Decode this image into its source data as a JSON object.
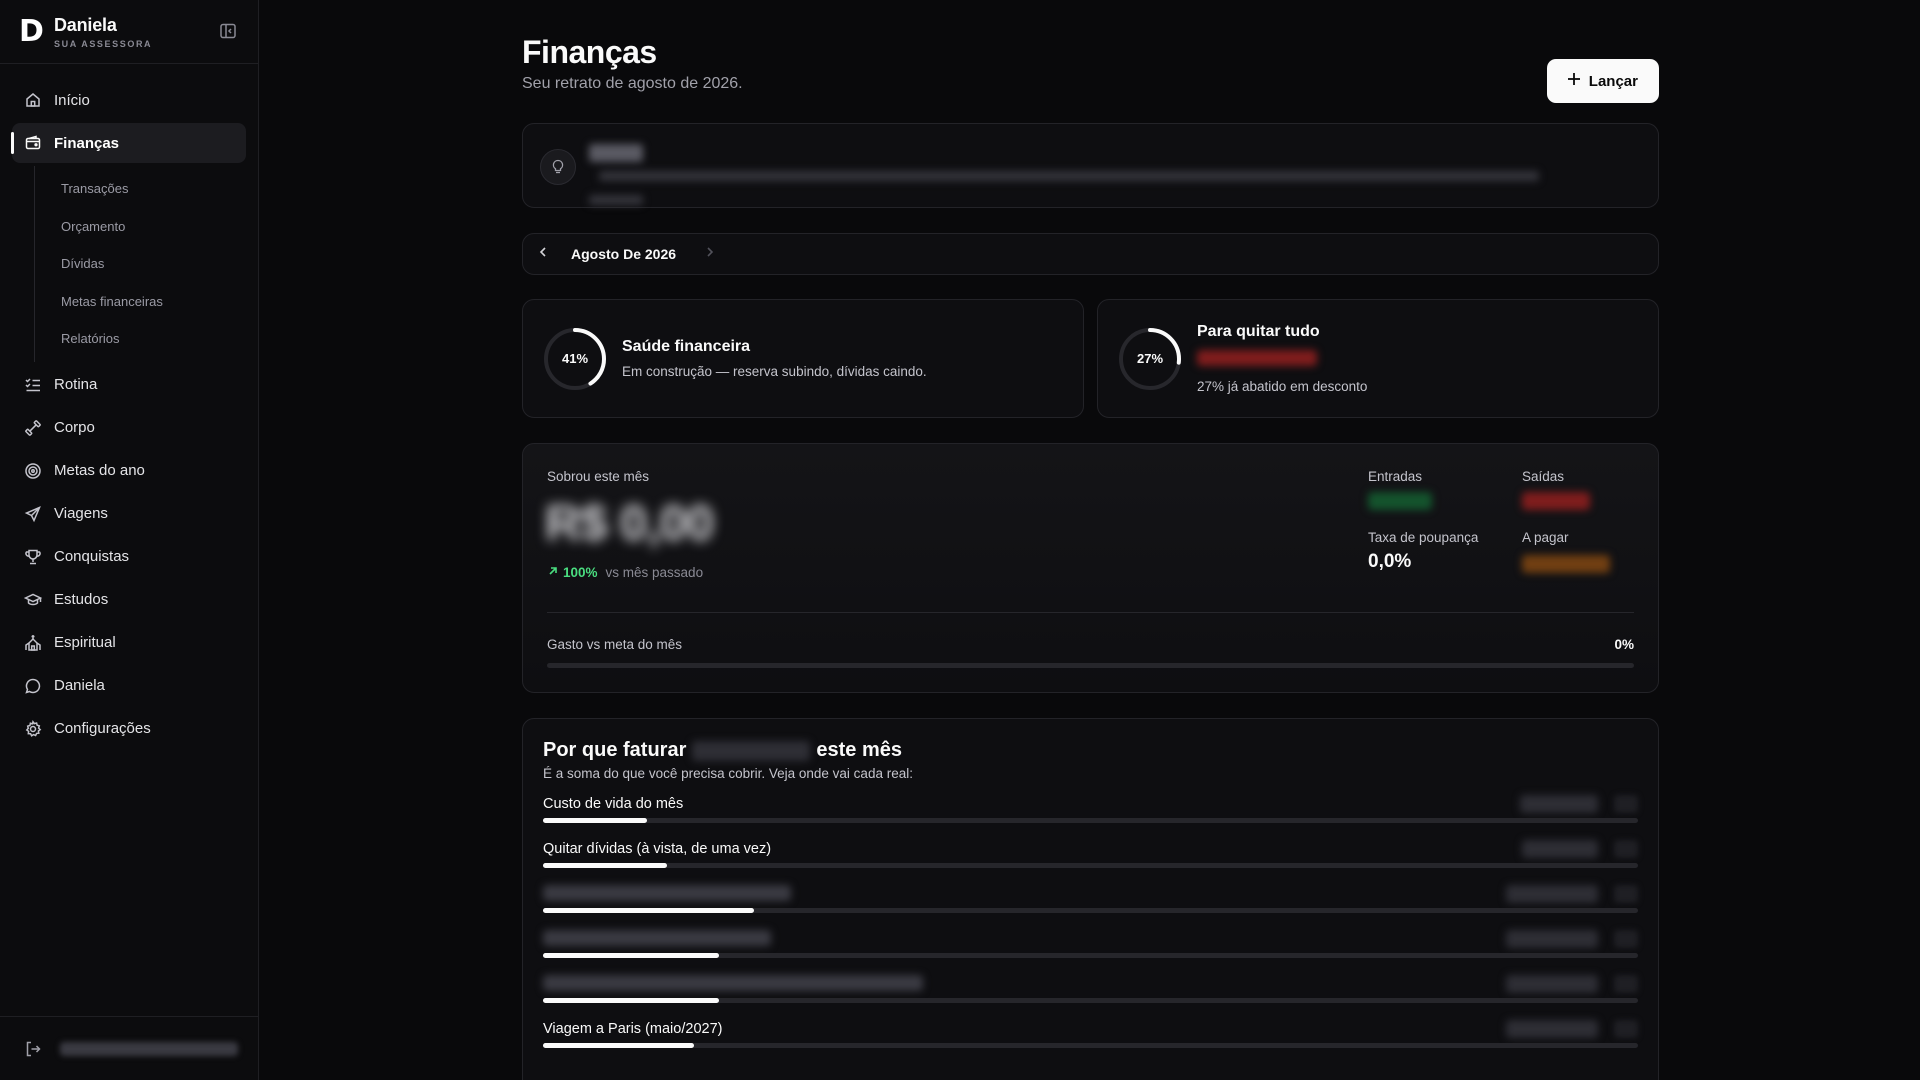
{
  "brand": {
    "logo": "D",
    "name": "Daniela",
    "subtitle": "SUA ASSESSORA"
  },
  "nav": {
    "items": [
      {
        "label": "Início",
        "icon": "home-icon"
      },
      {
        "label": "Finanças",
        "icon": "wallet-icon",
        "active": true
      },
      {
        "label": "Rotina",
        "icon": "list-checks-icon"
      },
      {
        "label": "Corpo",
        "icon": "dumbbell-icon"
      },
      {
        "label": "Metas do ano",
        "icon": "target-icon"
      },
      {
        "label": "Viagens",
        "icon": "plane-icon"
      },
      {
        "label": "Conquistas",
        "icon": "trophy-icon"
      },
      {
        "label": "Estudos",
        "icon": "graduation-cap-icon"
      },
      {
        "label": "Espiritual",
        "icon": "church-icon"
      },
      {
        "label": "Daniela",
        "icon": "chat-bubble-icon"
      },
      {
        "label": "Configurações",
        "icon": "gear-icon"
      }
    ],
    "sub_items": [
      "Transações",
      "Orçamento",
      "Dívidas",
      "Metas financeiras",
      "Relatórios"
    ]
  },
  "header": {
    "title": "Finanças",
    "subtitle": "Seu retrato de agosto de 2026.",
    "action_label": "Lançar"
  },
  "month_nav": {
    "label": "Agosto De 2026"
  },
  "health": {
    "percent": 41,
    "percent_label": "41%",
    "title": "Saúde financeira",
    "description": "Em construção — reserva subindo, dívidas caindo."
  },
  "payoff": {
    "percent": 27,
    "percent_label": "27%",
    "title": "Para quitar tudo",
    "description": "27% já abatido em desconto"
  },
  "summary": {
    "left_label": "Sobrou este mês",
    "amount": "R$ 0,00",
    "delta_pct": "100%",
    "delta_text": "vs mês passado",
    "entradas_label": "Entradas",
    "saidas_label": "Saídas",
    "taxa_label": "Taxa de poupança",
    "taxa_value": "0,0%",
    "apagar_label": "A pagar",
    "meta_label": "Gasto vs meta do mês",
    "meta_pct": "0%",
    "meta_fill": 0
  },
  "why": {
    "title_prefix": "Por que faturar",
    "title_suffix": "este mês",
    "subtitle": "É a soma do que você precisa cobrir. Veja onde vai cada real:",
    "rows": [
      {
        "label": "Custo de vida do mês",
        "fill": 0.095
      },
      {
        "label": "Quitar dívidas (à vista, de uma vez)",
        "fill": 0.113
      },
      {
        "label": "",
        "fill": 0.193
      },
      {
        "label": "",
        "fill": 0.161
      },
      {
        "label": "",
        "fill": 0.161
      },
      {
        "label": "Viagem a Paris (maio/2027)",
        "fill": 0.138
      }
    ]
  },
  "colors": {
    "accent": "#fafafa",
    "positive": "#4ade80",
    "negative": "#ef4444",
    "warning": "#eab308"
  }
}
